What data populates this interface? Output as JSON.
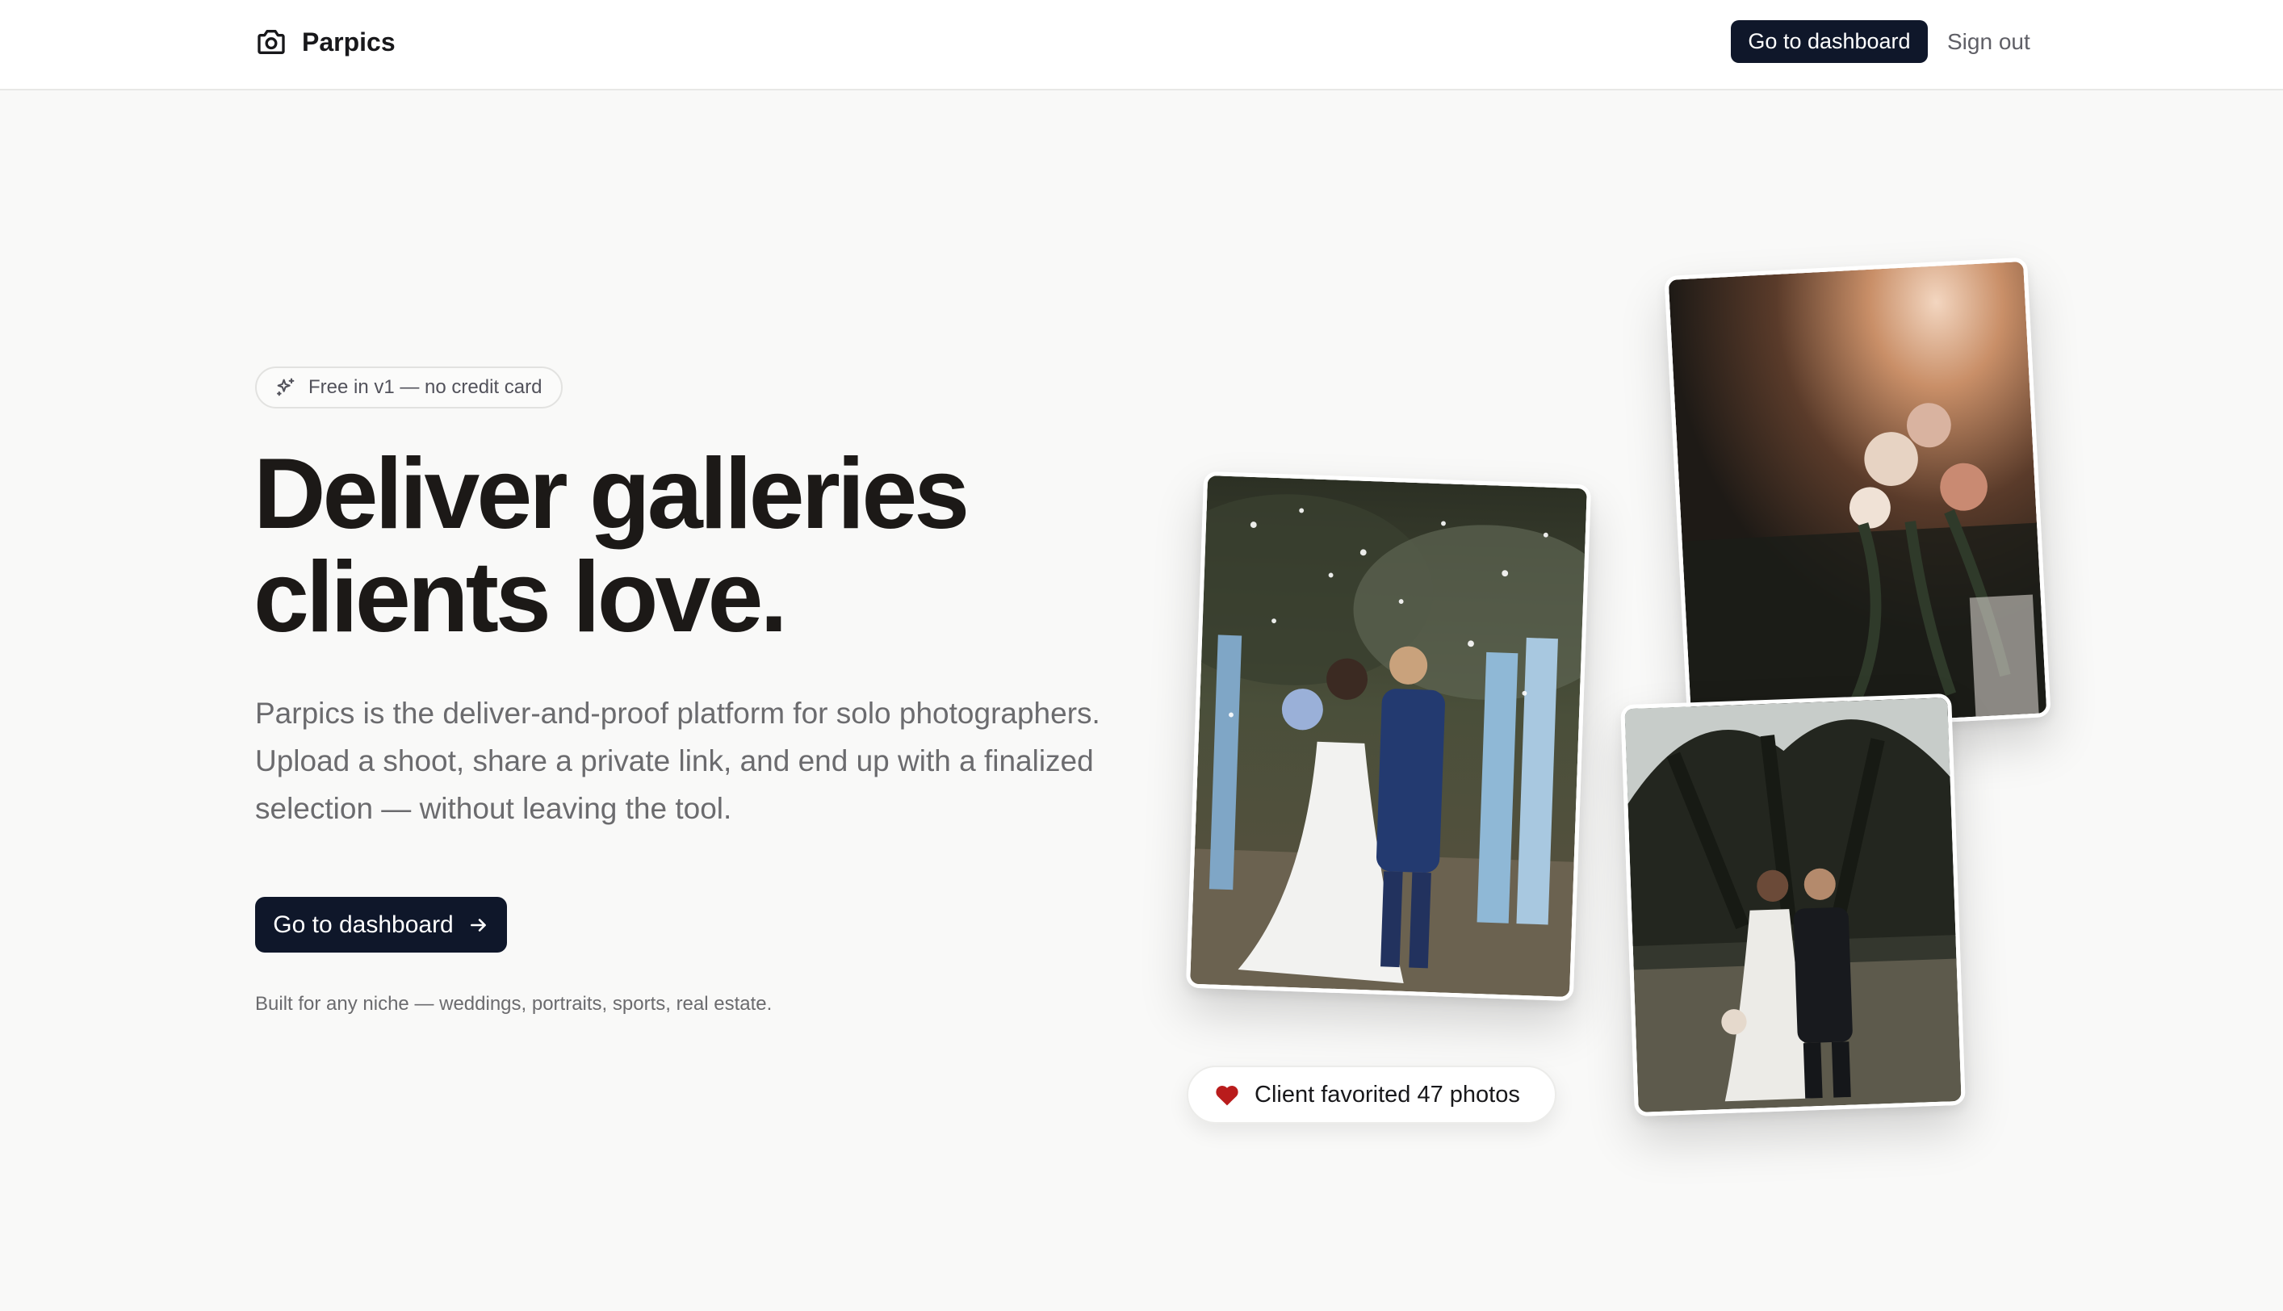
{
  "app": {
    "name": "Parpics"
  },
  "nav": {
    "dashboard_label": "Go to dashboard",
    "signout_label": "Sign out"
  },
  "hero": {
    "badge": "Free in v1 — no credit card",
    "title_line1": "Deliver galleries",
    "title_line2": "clients love.",
    "subtitle": "Parpics is the deliver-and-proof platform for solo photographers. Upload a shoot, share a private link, and end up with a finalized selection — without leaving the tool.",
    "cta_label": "Go to dashboard",
    "niche_note": "Built for any niche — weddings, portraits, sports, real estate."
  },
  "showcase": {
    "favorite_note": "Client favorited 47 photos"
  },
  "icons": {
    "brand": "camera-icon",
    "badge": "sparkles-icon",
    "cta": "arrow-right-icon",
    "favorite": "heart-icon"
  },
  "colors": {
    "primary": "#0f172a",
    "background": "#f9f9f8",
    "heart": "#b91c1c",
    "muted_text": "#6b6b6e"
  }
}
